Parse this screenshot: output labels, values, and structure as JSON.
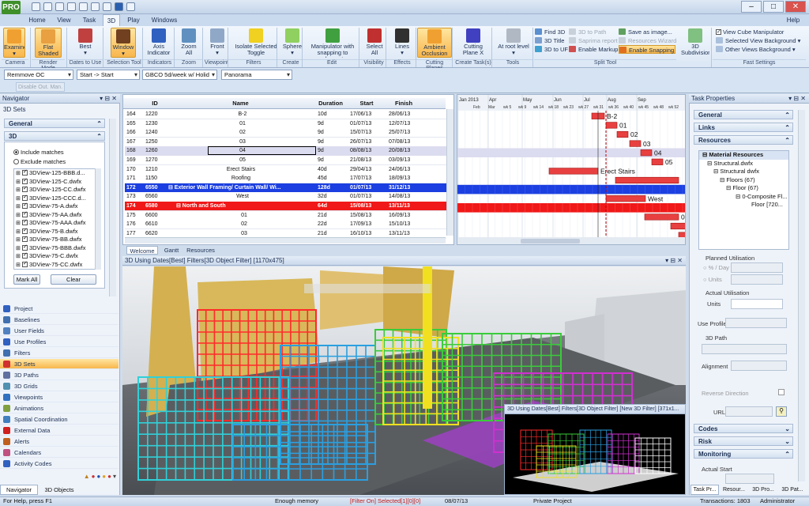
{
  "app": {
    "logo": "PRO"
  },
  "ribbon_tabs": [
    "Home",
    "View",
    "Task",
    "3D",
    "Play",
    "Windows"
  ],
  "active_tab": "3D",
  "help": "Help",
  "ribbon": {
    "buttons": [
      {
        "label": "Examine",
        "sub": "▾",
        "icon": "examine-icon",
        "color": "#f0a030"
      },
      {
        "label": "Flat Shaded",
        "sub": "▾",
        "icon": "flat-shaded-icon",
        "color": "#e8a040"
      },
      {
        "label": "Best",
        "sub": "▾",
        "icon": "best-icon",
        "color": "#c04040"
      },
      {
        "label": "Window",
        "sub": "▾",
        "icon": "window-icon",
        "color": "#704020"
      },
      {
        "label": "Axis Indicator",
        "sub": "▾",
        "icon": "axis-icon",
        "color": "#3060c0"
      },
      {
        "label": "Zoom All",
        "sub": "▾",
        "icon": "zoom-icon",
        "color": "#6090c0"
      },
      {
        "label": "Front",
        "sub": "▾",
        "icon": "front-icon",
        "color": "#90a8c8"
      },
      {
        "label": "Isolate Selected Toggle",
        "sub": "▾",
        "icon": "bulb-icon",
        "color": "#f0d020"
      },
      {
        "label": "Sphere",
        "sub": "▾",
        "icon": "sphere-icon",
        "color": "#90d060"
      },
      {
        "label": "Manipulator with snapping to element",
        "sub": "▾",
        "icon": "manipulator-icon",
        "color": "#40a040"
      },
      {
        "label": "Select All",
        "sub": "▾",
        "icon": "select-icon",
        "color": "#c03030"
      },
      {
        "label": "Lines",
        "sub": "▾",
        "icon": "lines-icon",
        "color": "#303030"
      },
      {
        "label": "Ambient Occlusion",
        "sub": "▾",
        "icon": "ambient-icon",
        "color": "#f0a030"
      },
      {
        "label": "Cutting Plane X",
        "sub": "▾",
        "icon": "cutting-plane-icon",
        "color": "#4040c0"
      },
      {
        "label": "At root level",
        "sub": "▾",
        "icon": "root-level-icon",
        "color": "#b0b8c4"
      },
      {
        "label": "3D Subdivision",
        "sub": "",
        "icon": "subdivision-icon",
        "color": "#80c080"
      }
    ],
    "groups": [
      "Camera",
      "Render Mode",
      "Dates to Use",
      "Selection Tool",
      "Indicators",
      "Zoom",
      "Viewpoint",
      "Filters",
      "Create",
      "Edit",
      "Visibility",
      "Effects",
      "Cutting Planes",
      "Create Task(s)",
      "Tools",
      "Split Tool",
      "Fast Settings"
    ],
    "tools_small": [
      {
        "label": "Find 3D",
        "disabled": false,
        "highlight": false
      },
      {
        "label": "3D Title",
        "disabled": false,
        "highlight": false
      },
      {
        "label": "3D to UF",
        "disabled": false,
        "highlight": false
      },
      {
        "label": "3D to Path",
        "disabled": true,
        "highlight": false
      },
      {
        "label": "Saprima report",
        "disabled": true,
        "highlight": false
      },
      {
        "label": "Enable Markup",
        "disabled": false,
        "highlight": false
      },
      {
        "label": "Save as image...",
        "disabled": false,
        "highlight": false
      },
      {
        "label": "Resources Wizard",
        "disabled": true,
        "highlight": false
      },
      {
        "label": "Enable Snapping",
        "disabled": false,
        "highlight": true
      }
    ],
    "fast_settings": [
      {
        "label": "View Cube Manipulator",
        "checked": true
      },
      {
        "label": "Selected View Background",
        "sub": "▾"
      },
      {
        "label": "Other Views Background",
        "sub": "▾"
      }
    ]
  },
  "filters": {
    "combo1": "Remmove OC",
    "combo2": "Start -> Start",
    "combo3": "GBCO 5d/week w/ Holid",
    "combo4": "Panorama",
    "disable_btn": "Disable Out. Man."
  },
  "navigator": {
    "title": "Navigator",
    "subtitle": "3D Sets",
    "general": "General",
    "threeD": "3D",
    "include": "Include matches",
    "exclude": "Exclude matches",
    "files": [
      "3DView-125-BBB.d...",
      "3DView-125-C.dwfx",
      "3DView-125-CC.dwfx",
      "3DView-125-CCC.d...",
      "3DView-75-A.dwfx",
      "3DView-75-AA.dwfx",
      "3DView-75-AAA.dwfx",
      "3DView-75-B.dwfx",
      "3DView-75-BB.dwfx",
      "3DView-75-BBB.dwfx",
      "3DView-75-C.dwfx",
      "3DView-75-CC.dwfx"
    ],
    "mark_all": "Mark All",
    "clear": "Clear",
    "items": [
      "Project",
      "Baselines",
      "User Fields",
      "Use Profiles",
      "Filters",
      "3D Sets",
      "3D Paths",
      "3D Grids",
      "Viewpoints",
      "Animations",
      "Spatial Coordination",
      "External Data",
      "Alerts",
      "Calendars",
      "Activity Codes"
    ],
    "selected": "3D Sets",
    "bottom_tabs": [
      "Navigator",
      "3D Objects"
    ]
  },
  "grid": {
    "columns": [
      "ID",
      "Name",
      "Duration",
      "Start",
      "Finish"
    ],
    "rows": [
      {
        "n": "164",
        "id": "1220",
        "name": "B-2",
        "dur": "10d",
        "start": "17/06/13",
        "finish": "28/06/13",
        "style": "normal",
        "indent": 2
      },
      {
        "n": "165",
        "id": "1230",
        "name": "01",
        "dur": "9d",
        "start": "01/07/13",
        "finish": "12/07/13",
        "style": "normal",
        "indent": 2
      },
      {
        "n": "166",
        "id": "1240",
        "name": "02",
        "dur": "9d",
        "start": "15/07/13",
        "finish": "25/07/13",
        "style": "normal",
        "indent": 2
      },
      {
        "n": "167",
        "id": "1250",
        "name": "03",
        "dur": "9d",
        "start": "26/07/13",
        "finish": "07/08/13",
        "style": "normal",
        "indent": 2
      },
      {
        "n": "168",
        "id": "1260",
        "name": "04",
        "dur": "9d",
        "start": "08/08/13",
        "finish": "20/08/13",
        "style": "selected",
        "indent": 2
      },
      {
        "n": "169",
        "id": "1270",
        "name": "05",
        "dur": "9d",
        "start": "21/08/13",
        "finish": "03/09/13",
        "style": "normal",
        "indent": 2
      },
      {
        "n": "170",
        "id": "1210",
        "name": "Erect Stairs",
        "dur": "40d",
        "start": "29/04/13",
        "finish": "24/06/13",
        "style": "normal",
        "indent": 1
      },
      {
        "n": "171",
        "id": "1150",
        "name": "Roofing",
        "dur": "45d",
        "start": "17/07/13",
        "finish": "18/09/13",
        "style": "normal",
        "indent": 1
      },
      {
        "n": "172",
        "id": "6550",
        "name": "⊟ Exterior Wall Framing/ Curtain Wall/ Wi...",
        "dur": "128d",
        "start": "01/07/13",
        "finish": "31/12/13",
        "style": "blue",
        "indent": 0
      },
      {
        "n": "173",
        "id": "6560",
        "name": "West",
        "dur": "32d",
        "start": "01/07/13",
        "finish": "14/08/13",
        "style": "normal",
        "indent": 2
      },
      {
        "n": "174",
        "id": "6580",
        "name": "⊟ North and South",
        "dur": "64d",
        "start": "15/08/13",
        "finish": "13/11/13",
        "style": "red",
        "indent": 1
      },
      {
        "n": "175",
        "id": "6600",
        "name": "01",
        "dur": "21d",
        "start": "15/08/13",
        "finish": "16/09/13",
        "style": "normal",
        "indent": 3
      },
      {
        "n": "176",
        "id": "6610",
        "name": "02",
        "dur": "22d",
        "start": "17/09/13",
        "finish": "15/10/13",
        "style": "normal",
        "indent": 3
      },
      {
        "n": "177",
        "id": "6620",
        "name": "03",
        "dur": "21d",
        "start": "16/10/13",
        "finish": "13/11/13",
        "style": "normal",
        "indent": 3
      }
    ]
  },
  "gantt": {
    "months": [
      "Jan 2013",
      "Apr",
      "May",
      "Jun",
      "Jul",
      "Aug",
      "Sep"
    ],
    "subrow": [
      "Feb",
      "Mar",
      "wk 5",
      "wk 9",
      "wk 14",
      "wk 18",
      "wk 23",
      "wk 27",
      "wk 31",
      "wk 36",
      "wk 40",
      "wk 45",
      "wk 48",
      "wk 52"
    ],
    "labels": [
      "B-2",
      "01",
      "02",
      "03",
      "04",
      "05",
      "Erect Stairs",
      "West",
      "0"
    ]
  },
  "view_tabs": [
    "Welcome",
    "Gantt",
    "Resources"
  ],
  "view3d": {
    "title": "3D Using Dates[Best] Filters[3D Object Filter] [1170x475]",
    "inset_title": "3D Using Dates[Best] Filters[3D Object Filter] [New 3D Filter] [371x1...",
    "colors": {
      "red": "#ff2a2a",
      "blue": "#2a9fe0",
      "green": "#3acc3a",
      "yellow": "#f0e020",
      "magenta": "#d030d0",
      "cyan": "#30d0d8",
      "building": "#c8a850"
    }
  },
  "task_properties": {
    "title": "Task Properties",
    "sections": [
      "General",
      "Links",
      "Resources"
    ],
    "tree_root": "Material Resources",
    "tree": [
      "Structural.dwfx",
      "Structural dwfx",
      "Floors (67)",
      "Floor (67)",
      "0-Composite Fl...",
      "Floor [720..."
    ],
    "planned": "Planned Utilisation",
    "per_day": "% / Day",
    "units": "Units",
    "actual": "Actual Utilisation",
    "actual_units": "Units",
    "use_profile": "Use Profile",
    "path": "3D Path",
    "alignment": "Alignment",
    "reverse": "Reverse Direction",
    "url": "URL",
    "bottom_sections": [
      "Codes",
      "Risk",
      "Monitoring"
    ],
    "actual_start": "Actual Start",
    "bottom_tabs": [
      "Task Pr...",
      "Resour...",
      "3D Pro...",
      "3D Pat..."
    ]
  },
  "status": {
    "help": "For Help, press F1",
    "memory": "Enough memory",
    "filter": "[Filter On]",
    "selected": "Selected[1][0][0]",
    "date": "08/07/13",
    "privacy": "Private Project",
    "transactions": "Transactions: 1803",
    "role": "Administrator"
  }
}
